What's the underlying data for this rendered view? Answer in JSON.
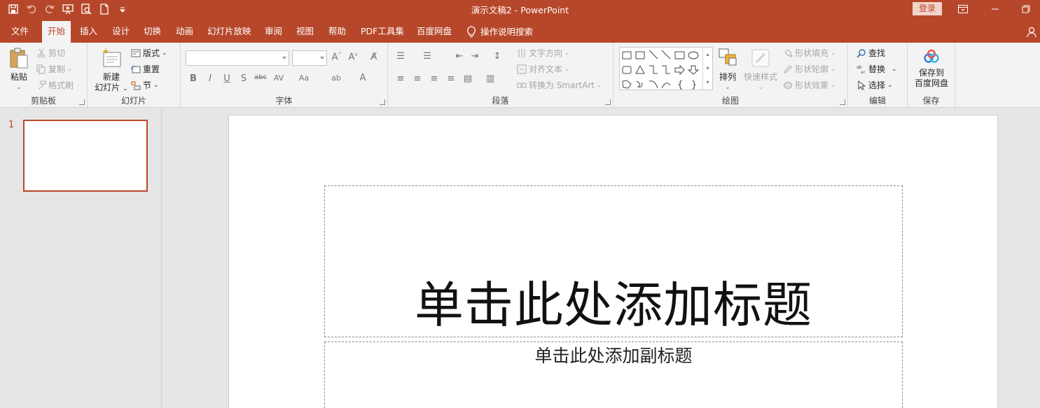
{
  "window": {
    "title": "演示文稿2  -  PowerPoint",
    "login_label": "登录",
    "accent_color": "#b7472a"
  },
  "quick_access": [
    {
      "icon": "save-icon"
    },
    {
      "icon": "undo-icon"
    },
    {
      "icon": "redo-icon"
    },
    {
      "icon": "present-from-start-icon"
    },
    {
      "icon": "print-preview-icon"
    },
    {
      "icon": "new-file-icon"
    },
    {
      "icon": "customize-qat-icon"
    }
  ],
  "tabs": [
    {
      "label": "文件"
    },
    {
      "label": "开始",
      "active": true
    },
    {
      "label": "插入"
    },
    {
      "label": "设计"
    },
    {
      "label": "切换"
    },
    {
      "label": "动画"
    },
    {
      "label": "幻灯片放映"
    },
    {
      "label": "审阅"
    },
    {
      "label": "视图"
    },
    {
      "label": "帮助"
    },
    {
      "label": "PDF工具集"
    },
    {
      "label": "百度网盘"
    }
  ],
  "tell_me": "操作说明搜索",
  "ribbon": {
    "clipboard": {
      "label": "剪贴板",
      "paste": "粘贴",
      "cut": "剪切",
      "copy": "复制",
      "format_painter": "格式刷"
    },
    "slides": {
      "label": "幻灯片",
      "new_slide_line1": "新建",
      "new_slide_line2": "幻灯片",
      "layout": "版式",
      "reset": "重置",
      "section": "节"
    },
    "font": {
      "label": "字体"
    },
    "paragraph": {
      "label": "段落",
      "text_direction": "文字方向",
      "align_text": "对齐文本",
      "convert_smartart": "转换为 SmartArt"
    },
    "drawing": {
      "label": "绘图",
      "arrange": "排列",
      "quick_styles": "快速样式",
      "shape_fill": "形状填充",
      "shape_outline": "形状轮廓",
      "shape_effects": "形状效果"
    },
    "editing": {
      "label": "编辑",
      "find": "查找",
      "replace": "替换",
      "select": "选择"
    },
    "save": {
      "label": "保存",
      "save_to_line1": "保存到",
      "save_to_line2": "百度网盘"
    }
  },
  "thumbnails": [
    {
      "number": "1"
    }
  ],
  "slide": {
    "title_placeholder": "单击此处添加标题",
    "subtitle_placeholder": "单击此处添加副标题"
  }
}
